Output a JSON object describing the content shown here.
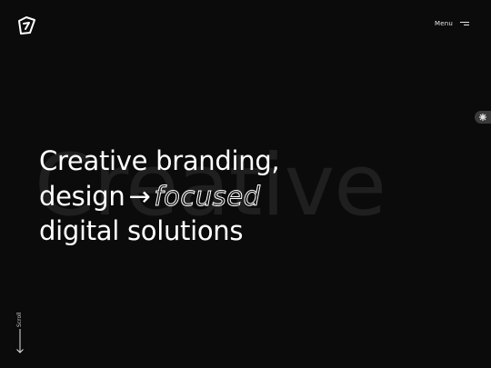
{
  "header": {
    "logo_icon": "brand-logo-mark",
    "menu_label": "Menu",
    "menu_icon": "hamburger-icon"
  },
  "side": {
    "toggle_icon": "gear-icon"
  },
  "hero": {
    "background_word": "Creative",
    "line1": "Creative branding,",
    "line2_start": "design",
    "line2_arrow": "→",
    "line2_outlined": "focused",
    "line3": "digital solutions"
  },
  "scroll": {
    "label": "Scroll",
    "icon": "arrow-down-icon"
  },
  "colors": {
    "background": "#0b0b0b",
    "text": "#ffffff",
    "background_word": "#1f1f1f",
    "toggle": "#3a3a3a"
  }
}
